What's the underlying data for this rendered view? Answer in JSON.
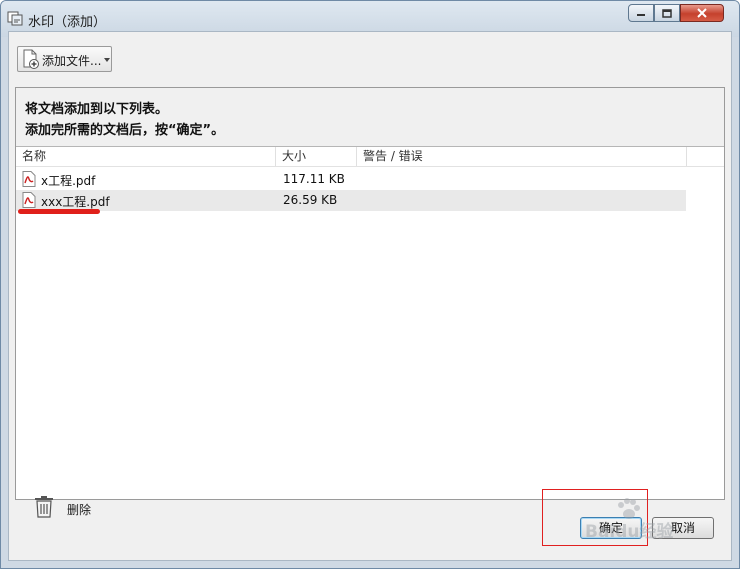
{
  "window": {
    "title": "水印（添加）"
  },
  "toolbar": {
    "add_files_label": "添加文件..."
  },
  "instructions": {
    "line1": "将文档添加到以下列表。",
    "line2": "添加完所需的文档后，按“确定”。"
  },
  "table": {
    "columns": [
      "名称",
      "大小",
      "警告 / 错误"
    ],
    "rows": [
      {
        "name": "x工程.pdf",
        "size": "117.11 KB",
        "warning": ""
      },
      {
        "name": "xxx工程.pdf",
        "size": "26.59 KB",
        "warning": ""
      }
    ]
  },
  "footer": {
    "delete_label": "删除"
  },
  "buttons": {
    "ok_label": "确定",
    "cancel_label": "取消"
  },
  "watermark": {
    "brand": "Baidu经验"
  },
  "colors": {
    "annotation_red": "#e02020",
    "pdf_red": "#cc2222",
    "close_button": "#c5412d"
  }
}
